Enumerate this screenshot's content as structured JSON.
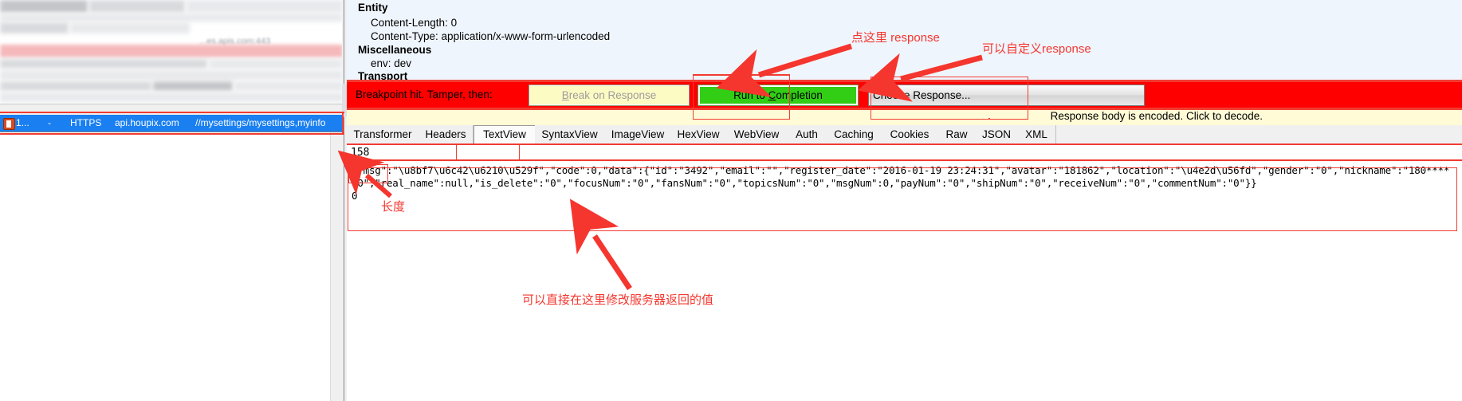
{
  "window": {
    "app": "Fiddler Web Debugger – Inspectors / Breakpoint"
  },
  "session_list": {
    "row": {
      "id": "1...",
      "result": "-",
      "protocol": "HTTPS",
      "host": "api.houpix.com",
      "url": "//mysettings/mysettings,myinfo"
    },
    "blurred_host_hint": "...es.apis.com:443"
  },
  "headers": {
    "sections": [
      {
        "title": "Entity",
        "rows": [
          "Content-Length: 0",
          "Content-Type: application/x-www-form-urlencoded"
        ]
      },
      {
        "title": "Miscellaneous",
        "rows": [
          "env: dev"
        ]
      },
      {
        "title": "Transport",
        "rows": []
      }
    ]
  },
  "breakpoint_bar": {
    "message": "Breakpoint hit. Tamper, then:",
    "break_on_response_label": "Break on Response",
    "break_on_response_accel": "B",
    "run_to_completion_label": "Run to Completion",
    "run_to_completion_accel": "C",
    "choose_response_label": "Choose Response...",
    "bar_color": "#fe0000",
    "run_button_color": "#32cd15",
    "break_button_color": "#fdfbc4"
  },
  "notice": {
    "encoded_text": "Response body is encoded. Click to decode."
  },
  "tabs": {
    "items": [
      "Transformer",
      "Headers",
      "TextView",
      "SyntaxView",
      "ImageView",
      "HexView",
      "WebView",
      "Auth",
      "Caching",
      "Cookies",
      "Raw",
      "JSON",
      "XML"
    ],
    "selected": "TextView"
  },
  "body": {
    "length": "158",
    "lines": [
      "{\"msg\":\"\\u8bf7\\u6c42\\u6210\\u529f\",\"code\":0,\"data\":{\"id\":\"3492\",\"email\":\"\",\"register_date\":\"2016-01-19 23:24:31\",\"avatar\":\"181862\",\"location\":\"\\u4e2d\\u56fd\",\"gender\":\"0\",\"nickname\":\"180****",
      "70\",\"real_name\":null,\"is_delete\":\"0\",\"focusNum\":\"0\",\"fansNum\":\"0\",\"topicsNum\":\"0\",\"msgNum\":0,\"payNum\":\"0\",\"shipNum\":\"0\",\"receiveNum\":\"0\",\"commentNum\":\"0\"}}",
      "0"
    ]
  },
  "annotations": {
    "accent_color": "#f23c32",
    "notes": [
      {
        "id": "click-here-response",
        "text": "点这里 response"
      },
      {
        "id": "custom-response",
        "text": "可以自定义response"
      },
      {
        "id": "length",
        "text": "长度"
      },
      {
        "id": "edit-server-value",
        "text": "可以直接在这里修改服务器返回的值"
      }
    ]
  }
}
